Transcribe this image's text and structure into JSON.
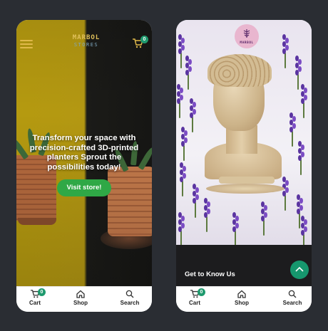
{
  "left_screen": {
    "header": {
      "logo_line1": "MARBOL",
      "logo_line2": "STORES",
      "cart_count": "0"
    },
    "hero": {
      "headline": "Transform your space with precision-crafted 3D-printed planters Sprout the possibilities today!",
      "cta_label": "Visit store!"
    },
    "bottom_nav": {
      "items": [
        {
          "label": "Cart",
          "icon": "cart-icon",
          "badge": "0"
        },
        {
          "label": "Shop",
          "icon": "home-icon"
        },
        {
          "label": "Search",
          "icon": "search-icon"
        }
      ]
    }
  },
  "right_screen": {
    "brand_badge": "MARBOL",
    "section_title": "Get to Know Us",
    "bottom_nav": {
      "items": [
        {
          "label": "Cart",
          "icon": "cart-icon",
          "badge": "0"
        },
        {
          "label": "Shop",
          "icon": "home-icon"
        },
        {
          "label": "Search",
          "icon": "search-icon"
        }
      ]
    }
  },
  "colors": {
    "accent_green": "#2fa846",
    "badge_teal": "#1f9a6e",
    "background": "#2a2d33"
  }
}
